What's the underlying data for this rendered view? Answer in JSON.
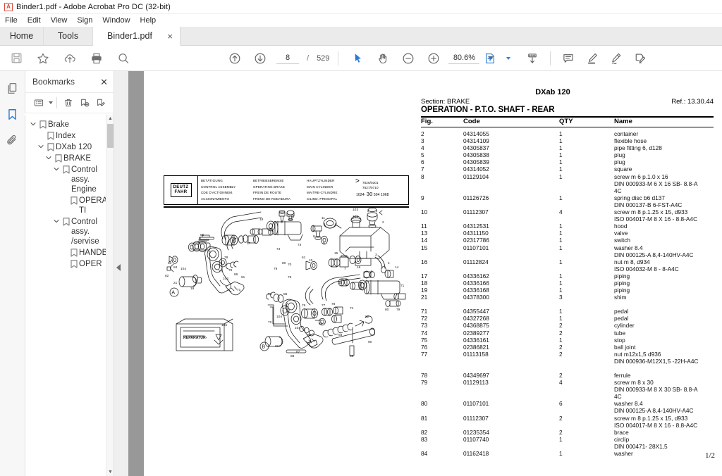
{
  "window": {
    "title": "Binder1.pdf - Adobe Acrobat Pro DC (32-bit)",
    "app_icon": "acrobat-icon"
  },
  "menubar": {
    "items": [
      "File",
      "Edit",
      "View",
      "Sign",
      "Window",
      "Help"
    ]
  },
  "tabs": {
    "home": "Home",
    "tools": "Tools",
    "document": "Binder1.pdf",
    "close": "×"
  },
  "toolbar": {
    "left_icons": [
      "save-icon",
      "star-icon",
      "upload-cloud-icon",
      "print-icon",
      "zoom-search-icon"
    ],
    "prev_page_icon": "arrow-up-circle-icon",
    "next_page_icon": "arrow-down-circle-icon",
    "page_current": "8",
    "page_separator": "/",
    "page_total": "529",
    "select_tool_icon": "cursor-arrow-icon",
    "hand_tool_icon": "hand-icon",
    "zoom_out_icon": "minus-circle-icon",
    "zoom_in_icon": "plus-circle-icon",
    "zoom_level": "80.6%",
    "fit_page_icon": "fit-page-icon",
    "scroll_mode_icon": "scroll-page-icon",
    "comment_icon": "comment-bubble-icon",
    "highlight_icon": "highlighter-icon",
    "draw_icon": "pen-draw-icon",
    "sign_icon": "sign-document-icon"
  },
  "rail": {
    "items": [
      {
        "name": "page-thumbnails-icon",
        "active": false
      },
      {
        "name": "bookmarks-icon",
        "active": true
      },
      {
        "name": "attachments-icon",
        "active": false
      }
    ]
  },
  "bookmarks_panel": {
    "title": "Bookmarks",
    "close": "✕",
    "toolbar_icons": [
      "options-list-icon",
      "delete-bookmark-icon",
      "new-bookmark-icon",
      "edit-bookmark-icon"
    ],
    "tree": [
      {
        "label": "Brake",
        "indent": 0,
        "twisty": "expanded"
      },
      {
        "label": "Index",
        "indent": 1,
        "twisty": "none"
      },
      {
        "label": "DXab 120",
        "indent": 1,
        "twisty": "expanded"
      },
      {
        "label": "BRAKE",
        "indent": 2,
        "twisty": "expanded"
      },
      {
        "label": "Control assy. Engine",
        "indent": 3,
        "twisty": "expanded"
      },
      {
        "label": "OPERATI",
        "indent": 4,
        "twisty": "none"
      },
      {
        "label": "Control assy. /servise",
        "indent": 3,
        "twisty": "expanded"
      },
      {
        "label": "HANDB",
        "indent": 4,
        "twisty": "none"
      },
      {
        "label": "OPER",
        "indent": 4,
        "twisty": "none"
      }
    ],
    "scrollbar": {
      "up": "▲",
      "down": "▼"
    }
  },
  "viewer": {
    "collapse_arrow": "collapse-left-arrow-icon"
  },
  "pdf": {
    "doc_title": "DXab 120",
    "section_label": "Section: BRAKE",
    "ref_label": "Ref.: 13.30.44",
    "operation_title": "OPERATION - P.T.O. SHAFT - REAR",
    "page_number": "1/2",
    "columns": [
      "Fig.",
      "Code",
      "QTY",
      "Name"
    ],
    "rows": [
      {
        "fig": "2",
        "code": "04314055",
        "qty": "1",
        "name": "container",
        "sub": ""
      },
      {
        "fig": "3",
        "code": "04314109",
        "qty": "1",
        "name": "flexible hose",
        "sub": ""
      },
      {
        "fig": "4",
        "code": "04305837",
        "qty": "1",
        "name": "pipe fitting 6, d128",
        "sub": ""
      },
      {
        "fig": "5",
        "code": "04305838",
        "qty": "1",
        "name": "plug",
        "sub": ""
      },
      {
        "fig": "6",
        "code": "04305839",
        "qty": "1",
        "name": "plug",
        "sub": ""
      },
      {
        "fig": "7",
        "code": "04314052",
        "qty": "1",
        "name": "square",
        "sub": ""
      },
      {
        "fig": "8",
        "code": "01129104",
        "qty": "1",
        "name": "screw m 6 p.1.0 x 16",
        "sub": "DIN 000933-M 6 X 16 SB- 8.8-A\n4C"
      },
      {
        "fig": "9",
        "code": "01126726",
        "qty": "1",
        "name": "spring disc b6 d137",
        "sub": "DIN 000137-B 6-FST-A4C"
      },
      {
        "fig": "10",
        "code": "01112307",
        "qty": "4",
        "name": "screw m 8 p.1.25 x 15, d933",
        "sub": "ISO 004017-M 8 X 16 - 8.8-A4C"
      },
      {
        "fig": "11",
        "code": "04312531",
        "qty": "1",
        "name": "hood",
        "sub": ""
      },
      {
        "fig": "13",
        "code": "04311150",
        "qty": "1",
        "name": "valve",
        "sub": ""
      },
      {
        "fig": "14",
        "code": "02317786",
        "qty": "1",
        "name": "switch",
        "sub": ""
      },
      {
        "fig": "15",
        "code": "01107101",
        "qty": "1",
        "name": "washer 8.4",
        "sub": "DIN 000125-A 8,4-140HV-A4C"
      },
      {
        "fig": "16",
        "code": "01112824",
        "qty": "1",
        "name": "nut m 8, d934",
        "sub": "ISO 004032-M 8 - 8-A4C"
      },
      {
        "fig": "17",
        "code": "04336162",
        "qty": "1",
        "name": "piping",
        "sub": ""
      },
      {
        "fig": "18",
        "code": "04336166",
        "qty": "1",
        "name": "piping",
        "sub": ""
      },
      {
        "fig": "19",
        "code": "04336168",
        "qty": "1",
        "name": "piping",
        "sub": ""
      },
      {
        "fig": "21",
        "code": "04378300",
        "qty": "3",
        "name": "shim",
        "sub": ""
      },
      {
        "fig": "71",
        "code": "04355447",
        "qty": "1",
        "name": "pedal",
        "sub": ""
      },
      {
        "fig": "72",
        "code": "04327268",
        "qty": "1",
        "name": "pedal",
        "sub": ""
      },
      {
        "fig": "73",
        "code": "04368875",
        "qty": "2",
        "name": "cylinder",
        "sub": ""
      },
      {
        "fig": "74",
        "code": "02389277",
        "qty": "2",
        "name": "tube",
        "sub": ""
      },
      {
        "fig": "75",
        "code": "04336161",
        "qty": "1",
        "name": "stop",
        "sub": ""
      },
      {
        "fig": "76",
        "code": "02386821",
        "qty": "2",
        "name": "ball joint",
        "sub": ""
      },
      {
        "fig": "77",
        "code": "01113158",
        "qty": "2",
        "name": "nut m12x1,5 d936",
        "sub": "DIN 000936-M12X1,5 -22H-A4C"
      },
      {
        "fig": "78",
        "code": "04349697",
        "qty": "2",
        "name": "ferrule",
        "sub": ""
      },
      {
        "fig": "79",
        "code": "01129113",
        "qty": "4",
        "name": "screw m 8 x 30",
        "sub": "DIN 000933-M 8 X 30 SB- 8.8-A\n4C"
      },
      {
        "fig": "80",
        "code": "01107101",
        "qty": "6",
        "name": "washer 8.4",
        "sub": "DIN 000125-A 8,4-140HV-A4C"
      },
      {
        "fig": "81",
        "code": "01112307",
        "qty": "2",
        "name": "screw m 8 p.1.25 x 15, d933",
        "sub": "ISO 004017-M 8 X 16 - 8.8-A4C"
      },
      {
        "fig": "82",
        "code": "01235354",
        "qty": "2",
        "name": "brace",
        "sub": ""
      },
      {
        "fig": "83",
        "code": "01107740",
        "qty": "1",
        "name": "circlip",
        "sub": "DIN 000471- 28X1,5"
      },
      {
        "fig": "84",
        "code": "01162418",
        "qty": "1",
        "name": "washer",
        "sub": ""
      }
    ],
    "drawing": {
      "logo_line1": "DEUTZ",
      "logo_line2": "FAHR",
      "col1": [
        "BETÄTIGUNG",
        "CONTROL ASSEMBLY",
        "CDE D'ACTIONNEM.",
        "ACCIONAMIENTO"
      ],
      "col2": [
        "BETRIEBSBREMSE",
        "OPERATING BRAKE",
        "FREIN DE ROUTE",
        "FRENO DE RODADURA"
      ],
      "col3": [
        "HAUPTZYLINDER",
        "MAIN CYLINDER",
        "MAITRE-CYLINDRE",
        "CILIND. PRINCIPAL"
      ],
      "ref1": "7626/0301",
      "ref2": "7627/0710",
      "bignum_prefix": "1024-",
      "bignum": "30",
      "bignum_suffix": "504  1068",
      "box_label": "REPARATUR-",
      "box_num": "105",
      "callout_a": "A",
      "callout_b": "B",
      "part_numbers": [
        "2",
        "3",
        "4",
        "5",
        "6",
        "7",
        "8",
        "9",
        "10",
        "11",
        "13",
        "14",
        "15",
        "16",
        "17",
        "18",
        "19",
        "21",
        "71",
        "72",
        "73",
        "74",
        "75",
        "76",
        "77",
        "78",
        "79",
        "80",
        "81",
        "82",
        "83",
        "84",
        "85",
        "86",
        "87",
        "89",
        "91",
        "93",
        "102",
        "103",
        "104",
        "105"
      ]
    }
  },
  "colors": {
    "accent_blue": "#2a7ad4",
    "tab_bg": "#ebebeb",
    "rail_bg": "#f7f7f7",
    "gutter_gray": "#989898",
    "acrobat_red": "#d94b3b"
  }
}
